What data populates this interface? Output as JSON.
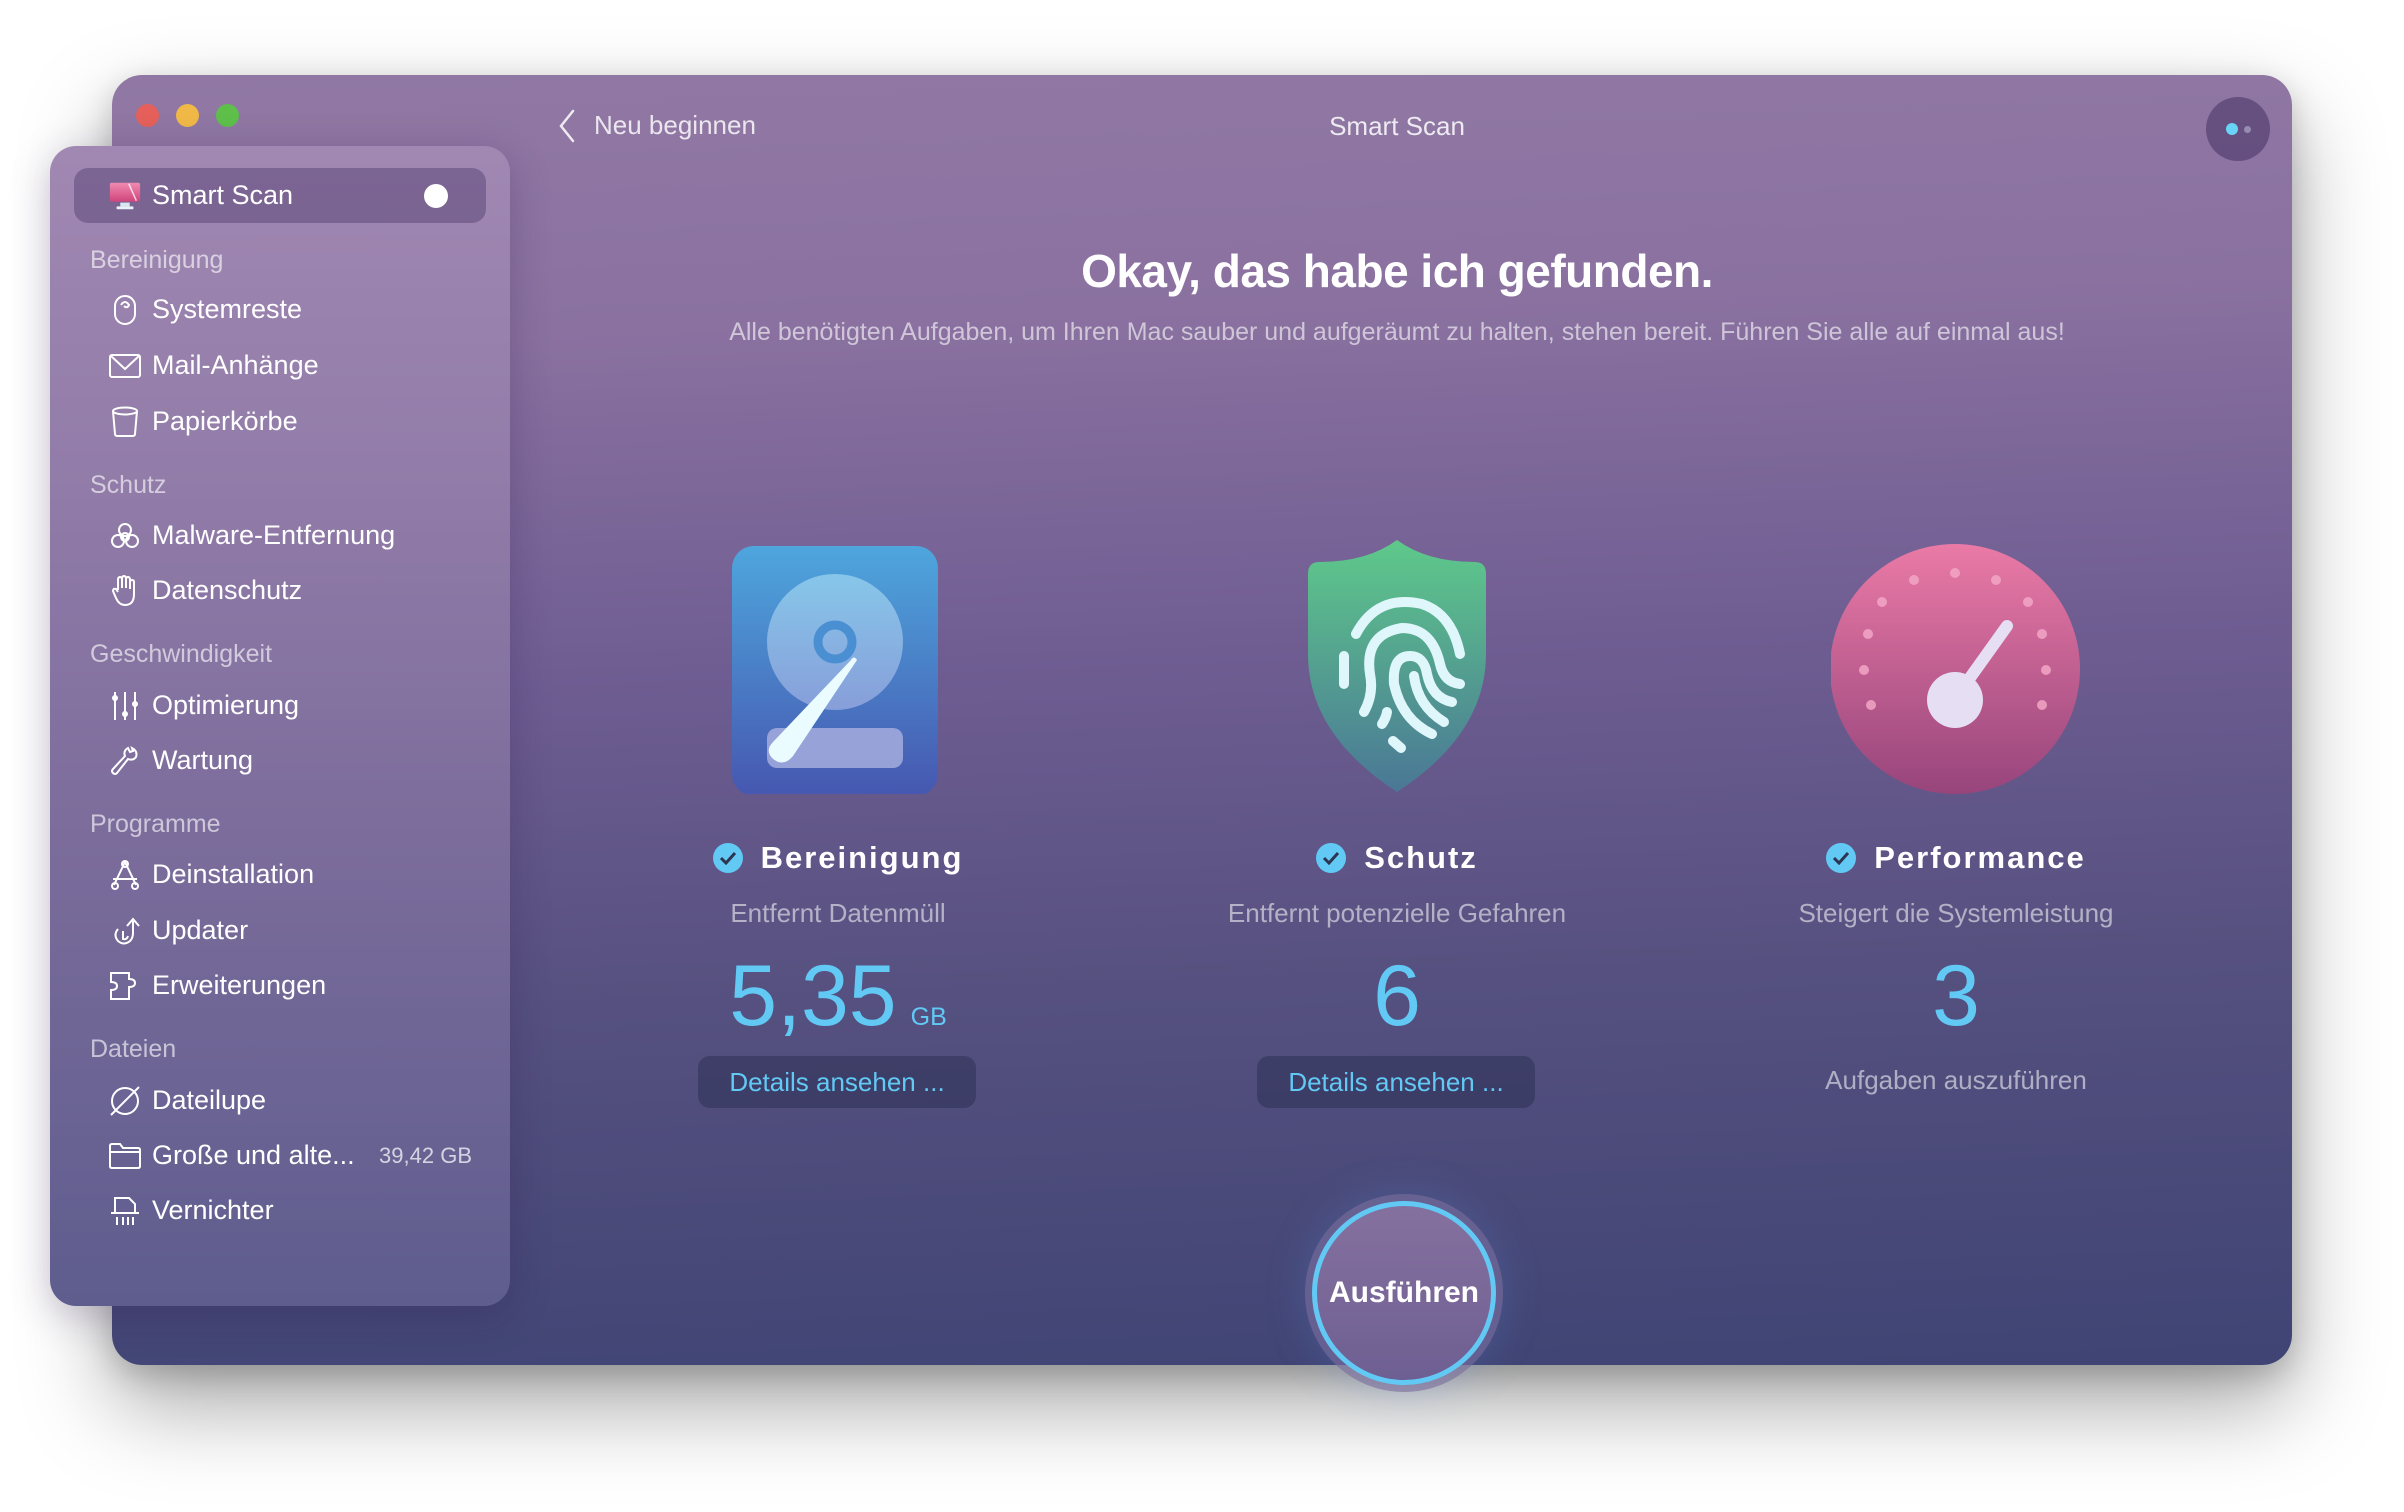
{
  "window": {
    "title": "Smart Scan",
    "back_label": "Neu beginnen",
    "traffic_lights": [
      "close",
      "minimize",
      "zoom"
    ]
  },
  "sidebar": {
    "active": {
      "label": "Smart Scan",
      "icon": "monitor-icon"
    },
    "sections": [
      {
        "label": "Bereinigung",
        "items": [
          {
            "label": "Systemreste",
            "icon": "system-junk-icon"
          },
          {
            "label": "Mail-Anhänge",
            "icon": "mail-icon"
          },
          {
            "label": "Papierkörbe",
            "icon": "trash-icon"
          }
        ]
      },
      {
        "label": "Schutz",
        "items": [
          {
            "label": "Malware-Entfernung",
            "icon": "biohazard-icon"
          },
          {
            "label": "Datenschutz",
            "icon": "hand-icon"
          }
        ]
      },
      {
        "label": "Geschwindigkeit",
        "items": [
          {
            "label": "Optimierung",
            "icon": "sliders-icon"
          },
          {
            "label": "Wartung",
            "icon": "wrench-icon"
          }
        ]
      },
      {
        "label": "Programme",
        "items": [
          {
            "label": "Deinstallation",
            "icon": "uninstaller-icon"
          },
          {
            "label": "Updater",
            "icon": "updater-icon"
          },
          {
            "label": "Erweiterungen",
            "icon": "extensions-icon"
          }
        ]
      },
      {
        "label": "Dateien",
        "items": [
          {
            "label": "Dateilupe",
            "icon": "space-lens-icon"
          },
          {
            "label": "Große und alte...",
            "icon": "folder-icon",
            "meta": "39,42 GB"
          },
          {
            "label": "Vernichter",
            "icon": "shredder-icon"
          }
        ]
      }
    ]
  },
  "main": {
    "heading": "Okay, das habe ich gefunden.",
    "subheading": "Alle benötigten Aufgaben, um Ihren Mac sauber und aufgeräumt zu halten, stehen bereit. Führen Sie alle auf einmal aus!",
    "cards": [
      {
        "title": "Bereinigung",
        "description": "Entfernt Datenmüll",
        "value": "5,35",
        "unit": "GB",
        "button": "Details ansehen ...",
        "icon": "hard-drive-icon"
      },
      {
        "title": "Schutz",
        "description": "Entfernt potenzielle Gefahren",
        "value": "6",
        "button": "Details ansehen ...",
        "icon": "shield-fingerprint-icon"
      },
      {
        "title": "Performance",
        "description": "Steigert die Systemleistung",
        "value": "3",
        "footer": "Aufgaben auszuführen",
        "icon": "speedometer-icon"
      }
    ],
    "run_button": "Ausführen"
  },
  "colors": {
    "accent": "#62c9f5",
    "window_top": "#9178a4",
    "window_bottom": "#3f4474",
    "close": "#e5605a",
    "minimize": "#f0b847",
    "zoom": "#5ebf4b"
  }
}
